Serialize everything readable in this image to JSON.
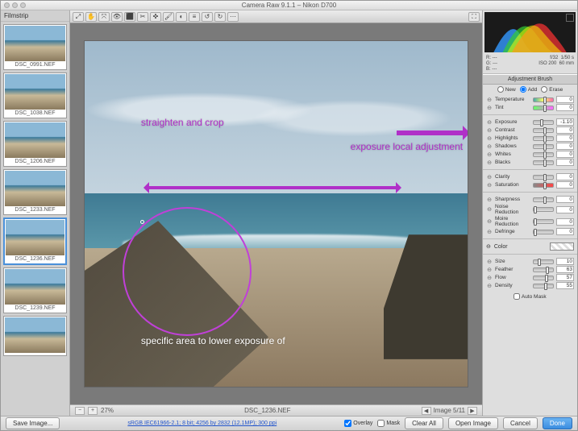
{
  "window": {
    "title": "Camera Raw 9.1.1 – Nikon D700"
  },
  "filmstrip": {
    "title": "Filmstrip",
    "thumbs": [
      {
        "label": "DSC_0991.NEF"
      },
      {
        "label": "DSC_1038.NEF"
      },
      {
        "label": "DSC_1206.NEF"
      },
      {
        "label": "DSC_1233.NEF"
      },
      {
        "label": "DSC_1236.NEF"
      },
      {
        "label": "DSC_1239.NEF"
      },
      {
        "label": ""
      }
    ],
    "selected_index": 4,
    "save_btn": "Save Image..."
  },
  "toolbar": {
    "tools": [
      "⤢",
      "✋",
      "⤧",
      "👁",
      "⬛",
      "✂",
      "✜",
      "🖌",
      "◐",
      "≡",
      "↺",
      "↻",
      "⋯"
    ],
    "fullscreen": "⛶"
  },
  "annotations": {
    "crop": "straighten and crop",
    "exposure": "exposure local adjustment",
    "area": "specific area to lower exposure  of"
  },
  "status": {
    "zoom_minus": "−",
    "zoom_plus": "+",
    "zoom": "27%",
    "filename": "DSC_1236.NEF",
    "counter": "Image 5/11",
    "prev": "◀",
    "next": "▶"
  },
  "meta": {
    "r": "R: ---",
    "f": "f/32",
    "sh": "1/50 s",
    "g": "G: ---",
    "iso": "ISO 200",
    "mm": "60 mm",
    "b": "B: ---"
  },
  "panel": {
    "title": "Adjustment Brush",
    "modes": {
      "new": "New",
      "add": "Add",
      "erase": "Erase"
    },
    "groups": {
      "basic": [
        {
          "name": "Temperature",
          "val": "0",
          "pos": 50,
          "grad": "grad1"
        },
        {
          "name": "Tint",
          "val": "0",
          "pos": 50,
          "grad": "grad2"
        }
      ],
      "tone": [
        {
          "name": "Exposure",
          "val": "-1.10",
          "pos": 32
        },
        {
          "name": "Contrast",
          "val": "0",
          "pos": 50
        },
        {
          "name": "Highlights",
          "val": "0",
          "pos": 50
        },
        {
          "name": "Shadows",
          "val": "0",
          "pos": 50
        },
        {
          "name": "Whites",
          "val": "0",
          "pos": 50
        },
        {
          "name": "Blacks",
          "val": "0",
          "pos": 50
        }
      ],
      "presence": [
        {
          "name": "Clarity",
          "val": "0",
          "pos": 50
        },
        {
          "name": "Saturation",
          "val": "0",
          "pos": 50,
          "grad": "gradsat"
        }
      ],
      "detail": [
        {
          "name": "Sharpness",
          "val": "0",
          "pos": 50
        },
        {
          "name": "Noise Reduction",
          "val": "0",
          "pos": 0
        },
        {
          "name": "Moire Reduction",
          "val": "0",
          "pos": 0
        },
        {
          "name": "Defringe",
          "val": "0",
          "pos": 0
        }
      ],
      "color_label": "Color",
      "brush": [
        {
          "name": "Size",
          "val": "10",
          "pos": 20
        },
        {
          "name": "Feather",
          "val": "63",
          "pos": 63
        },
        {
          "name": "Flow",
          "val": "57",
          "pos": 57
        },
        {
          "name": "Density",
          "val": "55",
          "pos": 55
        }
      ],
      "automask": "Auto Mask"
    }
  },
  "footer": {
    "profile": "sRGB IEC61966-2.1; 8 bit; 4256 by 2832 (12.1MP); 300 ppi",
    "overlay": "Overlay",
    "mask": "Mask",
    "clear": "Clear All",
    "open": "Open Image",
    "cancel": "Cancel",
    "done": "Done"
  }
}
